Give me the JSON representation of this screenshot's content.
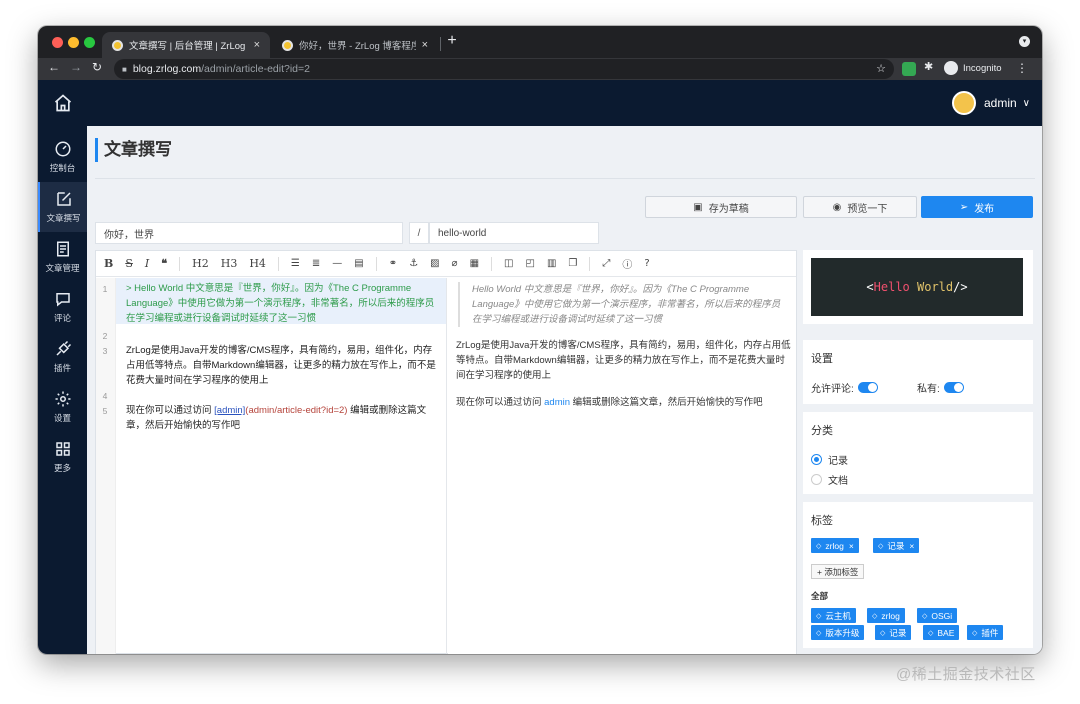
{
  "browser": {
    "tabs": [
      {
        "title": "文章撰写 | 后台管理 | ZrLog 博客",
        "close": "×"
      },
      {
        "title": "你好，世界 - ZrLog 博客程序 - ",
        "close": "×"
      }
    ],
    "new_tab": "+",
    "url_host": "blog.zrlog.com",
    "url_path": "/admin/article-edit?id=2",
    "profile_label": "Incognito"
  },
  "sidebar": {
    "items": [
      {
        "label": "控制台",
        "icon": "dashboard-icon"
      },
      {
        "label": "文章撰写",
        "icon": "edit-icon"
      },
      {
        "label": "文章管理",
        "icon": "document-icon"
      },
      {
        "label": "评论",
        "icon": "comment-icon"
      },
      {
        "label": "插件",
        "icon": "plug-icon"
      },
      {
        "label": "设置",
        "icon": "gear-icon"
      },
      {
        "label": "更多",
        "icon": "grid-icon"
      }
    ]
  },
  "header": {
    "username": "admin"
  },
  "page": {
    "title": "文章撰写",
    "save_draft": "存为草稿",
    "preview": "预览一下",
    "publish": "发布",
    "article_title": "你好，世界",
    "slash": "/",
    "alias": "hello-world"
  },
  "editor": {
    "toolbar": [
      "B",
      "S",
      "I",
      "❝",
      "H2",
      "H3",
      "H4"
    ],
    "line_numbers": [
      "1",
      "2",
      "3",
      "4",
      "5"
    ],
    "line1": "> Hello World 中文意思是『世界，你好』。因为《The C Programme Language》中使用它做为第一个演示程序，非常著名，所以后来的程序员在学习编程或进行设备调试时延续了这一习惯",
    "line3": "ZrLog是使用Java开发的博客/CMS程序，具有简约，易用，组件化，内存占用低等特点。自带Markdown编辑器，让更多的精力放在写作上，而不是花费大量时间在学习程序的使用上",
    "line5_prefix": "现在你可以通过访问 ",
    "line5_link_text": "[admin]",
    "line5_link_url": "(admin/article-edit?id=2)",
    "line5_suffix": " 编辑或删除这篇文章，然后开始愉快的写作吧"
  },
  "preview": {
    "quote": "Hello World 中文意思是『世界，你好』。因为《The C Programme Language》中使用它做为第一个演示程序，非常著名，所以后来的程序员在学习编程或进行设备调试时延续了这一习惯",
    "p1": "ZrLog是使用Java开发的博客/CMS程序，具有简约，易用，组件化，内存占用低等特点。自带Markdown编辑器，让更多的精力放在写作上，而不是花费大量时间在学习程序的使用上",
    "p2_prefix": "现在你可以通过访问 ",
    "p2_link": "admin",
    "p2_suffix": " 编辑或删除这篇文章，然后开始愉快的写作吧"
  },
  "panel": {
    "banner": {
      "lt": "<",
      "hello": "Hello",
      "world": "World",
      "end": "/>"
    },
    "settings_title": "设置",
    "allow_comment": "允许评论:",
    "private": "私有:",
    "category_title": "分类",
    "categories": [
      "记录",
      "文档"
    ],
    "tags_title": "标签",
    "selected_tags": [
      "zrlog",
      "记录"
    ],
    "tag_remove": "×",
    "add_tag": "+ 添加标签",
    "all_label": "全部",
    "all_tags": [
      "云主机",
      "zrlog",
      "OSGi",
      "版本升级",
      "记录",
      "BAE",
      "插件"
    ]
  },
  "watermark": "@稀土掘金技术社区",
  "colors": {
    "accent": "#1e87f0",
    "sidebar": "#0b1a30",
    "quote_green": "#2d9b4a"
  }
}
